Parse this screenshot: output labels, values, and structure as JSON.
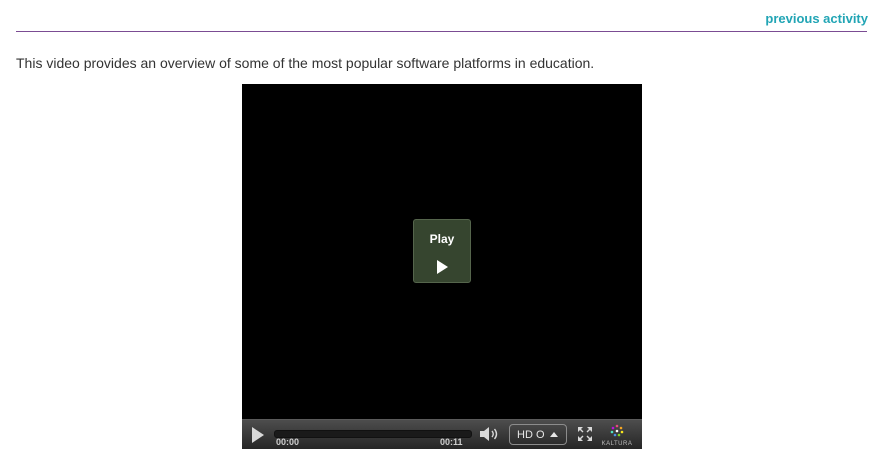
{
  "header": {
    "previous_link": "previous activity"
  },
  "content": {
    "intro": "This video provides an overview of some of the most popular software platforms in education."
  },
  "player": {
    "overlay_label": "Play",
    "current_time": "00:00",
    "total_time": "00:11",
    "quality": "HD O",
    "progress": 0,
    "logo_text": "KALTURA",
    "icons": [
      "play-icon",
      "volume-icon",
      "caret-up-icon",
      "fullscreen-icon",
      "kaltura-logo-icon"
    ],
    "colors": {
      "link": "#22a5b5",
      "divider": "#7b4c93",
      "overlay_bg": "#36452f"
    }
  }
}
